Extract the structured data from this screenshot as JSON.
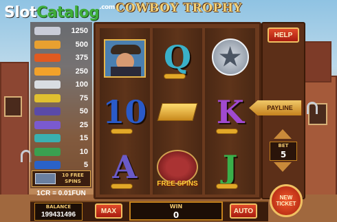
{
  "logo": {
    "slot": "Slot",
    "catalog": "Catalog",
    "com": ".com"
  },
  "game_title": "COWBOY TROPHY",
  "paytable": [
    {
      "icon": "sheriff-icon",
      "color": "#c9ccd8",
      "value": "1250"
    },
    {
      "icon": "badge-icon",
      "color": "#e8a030",
      "value": "500"
    },
    {
      "icon": "gold-icon",
      "color": "#e05a20",
      "value": "375"
    },
    {
      "icon": "horseshoe-icon",
      "color": "#f2a22a",
      "value": "250"
    },
    {
      "icon": "guns-icon",
      "color": "#d9dde2",
      "value": "100"
    },
    {
      "icon": "ace-icon",
      "color": "#e0c030",
      "value": "75"
    },
    {
      "icon": "king-icon",
      "color": "#5a4aa8",
      "value": "50"
    },
    {
      "icon": "queen-icon",
      "color": "#7a5ad0",
      "value": "25"
    },
    {
      "icon": "jack-icon",
      "color": "#3ab0b0",
      "value": "15"
    },
    {
      "icon": "ten-icon",
      "color": "#3aa050",
      "value": "10"
    },
    {
      "icon": "nine-icon",
      "color": "#2a62c8",
      "value": "5"
    }
  ],
  "free_spins_label": "10 FREE SPINS",
  "credit": "1CR = 0.01FUN",
  "reels": [
    {
      "symbols": [
        {
          "type": "sheriff"
        },
        {
          "type": "letter",
          "text": "10",
          "color": "#2a5ac8"
        },
        {
          "type": "letter",
          "text": "A",
          "color": "#6a5ac8"
        }
      ]
    },
    {
      "symbols": [
        {
          "type": "letter",
          "text": "Q",
          "color": "#3ab0c8"
        },
        {
          "type": "gold"
        },
        {
          "type": "freespins",
          "text": "FREE SPINS"
        }
      ]
    },
    {
      "symbols": [
        {
          "type": "star"
        },
        {
          "type": "letter",
          "text": "K",
          "color": "#a04ad0"
        },
        {
          "type": "letter",
          "text": "J",
          "color": "#3ab04a"
        }
      ]
    }
  ],
  "buttons": {
    "help": "HELP",
    "payline": "PAYLINE",
    "max": "MAX",
    "auto": "AUTO",
    "new_ticket": "NEW TICKET"
  },
  "bet": {
    "label": "BET",
    "value": "5"
  },
  "balance": {
    "label": "BALANCE",
    "value": "199431496"
  },
  "win": {
    "label": "WIN",
    "value": "0"
  },
  "colors": {
    "accent": "#c5821e",
    "button_red": "#c4301a",
    "frame": "#6b3a1e"
  }
}
